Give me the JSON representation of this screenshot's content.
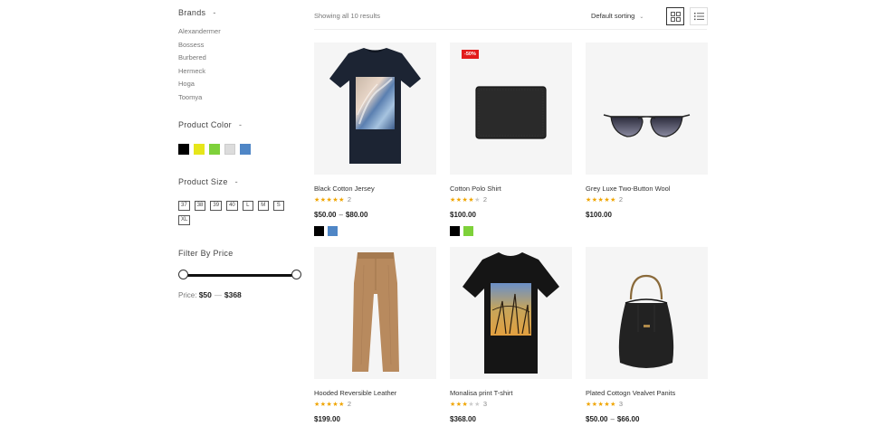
{
  "sidebar": {
    "brands": {
      "title": "Brands",
      "toggle": "-",
      "items": [
        "Alexandermer",
        "Bossess",
        "Burbered",
        "Hermeck",
        "Hoga",
        "Toomya"
      ]
    },
    "colors": {
      "title": "Product Color",
      "toggle": "-",
      "swatches": [
        "#000000",
        "#e6e61a",
        "#7ed13a",
        "#dcdcdc",
        "#4f86c6"
      ]
    },
    "sizes": {
      "title": "Product Size",
      "toggle": "-",
      "items": [
        "37",
        "38",
        "39",
        "40",
        "L",
        "M",
        "S",
        "XL"
      ]
    },
    "price": {
      "title": "Filter By Price",
      "label": "Price:",
      "min": "$50",
      "sep": "—",
      "max": "$368",
      "slider_min_fraction": 0,
      "slider_max_fraction": 1
    }
  },
  "toolbar": {
    "result_count": "Showing all 10 results",
    "sorting": "Default sorting",
    "grid_icon": "grid-view-icon",
    "list_icon": "list-view-icon"
  },
  "products": [
    {
      "name": "Black Cotton Jersey",
      "rating": 5,
      "stars_text": "★★★★★",
      "stars_off": "",
      "reviews": "2",
      "price_low": "$50.00",
      "price_high": "$80.00",
      "dash": "–",
      "colors": [
        "#000000",
        "#4f86c6"
      ],
      "image": "black-tshirt-graphic"
    },
    {
      "name": "Cotton Polo Shirt",
      "rating": 4,
      "stars_text": "★★★★",
      "stars_off": "★",
      "reviews": "2",
      "price": "$100.00",
      "badge": "-50%",
      "colors": [
        "#000000",
        "#7ed13a"
      ],
      "image": "black-wallet"
    },
    {
      "name": "Grey Luxe Two-Button Wool",
      "rating": 5,
      "stars_text": "★★★★★",
      "stars_off": "",
      "reviews": "2",
      "price": "$100.00",
      "image": "sunglasses"
    },
    {
      "name": "Hooded Reversible Leather",
      "rating": 4.5,
      "stars_text": "★★★★★",
      "stars_off": "",
      "reviews": "2",
      "price": "$199.00",
      "image": "brown-trousers"
    },
    {
      "name": "Monalisa print T-shirt",
      "rating": 3,
      "stars_text": "★★★",
      "stars_off": "★★",
      "reviews": "3",
      "price": "$368.00",
      "image": "black-tshirt-photo"
    },
    {
      "name": "Plated Cottogn Vealvet Panits",
      "rating": 5,
      "stars_text": "★★★★★",
      "stars_off": "",
      "reviews": "3",
      "price_low": "$50.00",
      "price_high": "$66.00",
      "dash": "–",
      "image": "black-bucket-bag"
    }
  ]
}
